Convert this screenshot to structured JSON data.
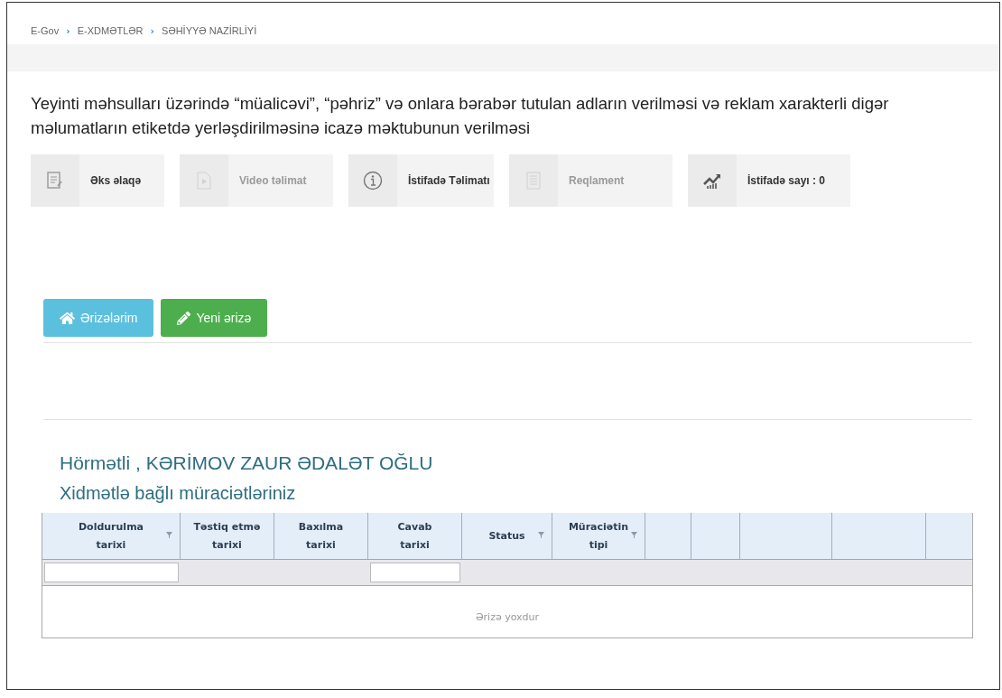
{
  "breadcrumb": [
    "E-Gov",
    "E-XDMƏTLƏR",
    "SƏHİYYƏ NAZİRLİYİ"
  ],
  "breadcrumb_separator": "›",
  "title": "Yeyinti məhsulları üzərində “müalicəvi”, “pəhriz” və onlara bərabər tutulan adların verilməsi və reklam xarakterli digər məlumatların etiketdə yerləşdirilməsinə icazə məktubunun verilməsi",
  "tiles": [
    {
      "kind": "feedback",
      "label": "Əks əlaqə",
      "disabled": false
    },
    {
      "kind": "video",
      "label": "Video təlimat",
      "disabled": true
    },
    {
      "kind": "info",
      "label": "İstifadə Təlimatı",
      "disabled": false
    },
    {
      "kind": "document",
      "label": "Reqlament",
      "disabled": true
    },
    {
      "kind": "stats",
      "label": "İstifadə sayı : 0",
      "disabled": false
    }
  ],
  "actions": [
    {
      "kind": "home",
      "label": "Ərizələrim"
    },
    {
      "kind": "new",
      "label": "Yeni ərizə"
    }
  ],
  "greeting": "Hörmətli , KƏRİMOV ZAUR ƏDALƏT OĞLU",
  "subtitle": "Xidmətlə bağlı müraciətləriniz",
  "table": {
    "columns": [
      {
        "kind": "label",
        "label": [
          "Doldurulma",
          "tarixi"
        ],
        "sortable": true,
        "filter_input": true
      },
      {
        "kind": "label",
        "label": [
          "Təstiq etmə",
          "tarixi"
        ],
        "sortable": false,
        "filter_input": false
      },
      {
        "kind": "label",
        "label": [
          "Baxılma",
          "tarixi"
        ],
        "sortable": false,
        "filter_input": false
      },
      {
        "kind": "label",
        "label": [
          "Cavab",
          "tarixi"
        ],
        "sortable": false,
        "filter_input": true
      },
      {
        "kind": "label",
        "label": [
          "Status"
        ],
        "sortable": true,
        "filter_input": false
      },
      {
        "kind": "label",
        "label": [
          "Müraciətin",
          "tipi"
        ],
        "sortable": true,
        "filter_input": false
      },
      {
        "kind": "blank"
      },
      {
        "kind": "blank"
      },
      {
        "kind": "blank"
      },
      {
        "kind": "blank"
      },
      {
        "kind": "blank"
      }
    ],
    "empty_message": "Ərizə yoxdur"
  }
}
